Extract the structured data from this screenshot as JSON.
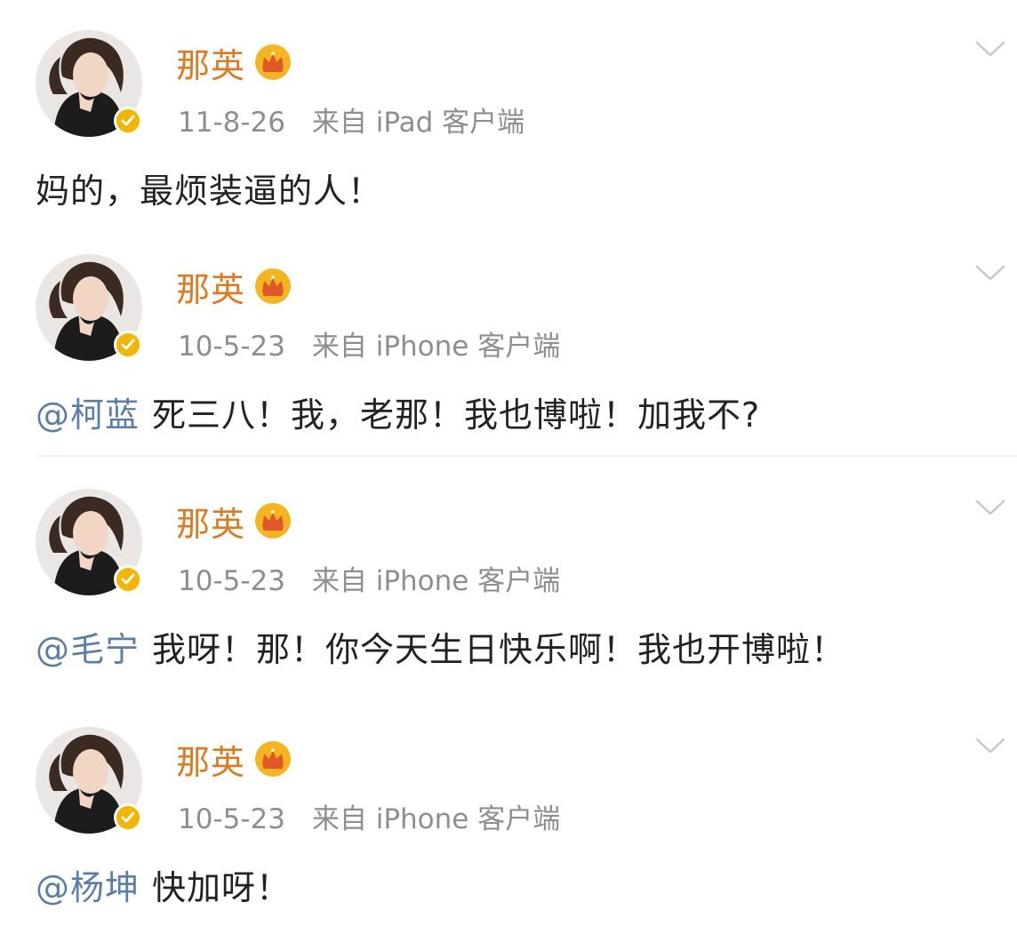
{
  "colors": {
    "username": "#e07a1f",
    "mention": "#5b7ea8",
    "meta": "#8e8e8e",
    "verified_badge": "#f4b400"
  },
  "icons": {
    "vip": "crown-icon",
    "verified": "verified-badge-icon",
    "expand": "chevron-down-icon"
  },
  "posts": [
    {
      "user": "那英",
      "date": "11-8-26",
      "source": "来自 iPad 客户端",
      "mention": "",
      "text": "妈的，最烦装逼的人！"
    },
    {
      "user": "那英",
      "date": "10-5-23",
      "source": "来自 iPhone 客户端",
      "mention": "@柯蓝",
      "text": "死三八！我，老那！我也博啦！加我不?"
    },
    {
      "user": "那英",
      "date": "10-5-23",
      "source": "来自 iPhone 客户端",
      "mention": "@毛宁",
      "text": "我呀！那！你今天生日快乐啊！我也开博啦！"
    },
    {
      "user": "那英",
      "date": "10-5-23",
      "source": "来自 iPhone 客户端",
      "mention": "@杨坤",
      "text": "快加呀！"
    }
  ]
}
